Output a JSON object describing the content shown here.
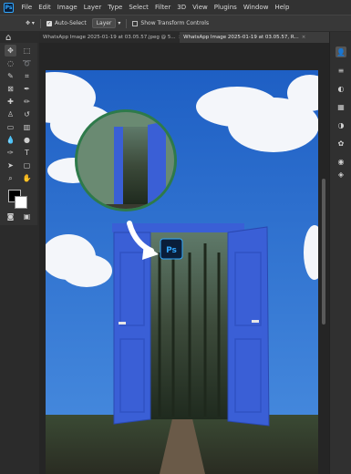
{
  "app": {
    "logo_text": "Ps"
  },
  "menu": [
    "File",
    "Edit",
    "Image",
    "Layer",
    "Type",
    "Select",
    "Filter",
    "3D",
    "View",
    "Plugins",
    "Window",
    "Help"
  ],
  "options": {
    "auto_select_label": "Auto-Select",
    "layer_select_value": "Layer",
    "show_transform_label": "Show Transform Controls"
  },
  "tabs": [
    {
      "label": "WhatsApp Image 2025-01-19 at 03.05.57.jpeg @ 5...",
      "close": "×"
    },
    {
      "label": "WhatsApp Image 2025-01-19 at 03.05.57, R...",
      "close": "×"
    }
  ],
  "canvas": {
    "badge_text": "Ps"
  },
  "colors": {
    "sky": "#2f6fd0",
    "door": "#3a5fd6",
    "accent": "#31a8ff",
    "ui_bg": "#2b2b2b"
  },
  "tool_icons": [
    "move-tool-icon",
    "marquee-tool-icon",
    "lasso-tool-icon",
    "crop-tool-icon",
    "eyedropper-tool-icon",
    "brush-tool-icon",
    "stamp-tool-icon",
    "eraser-tool-icon",
    "gradient-tool-icon",
    "pen-tool-icon",
    "type-tool-icon",
    "path-tool-icon",
    "hand-tool-icon",
    "zoom-tool-icon"
  ]
}
